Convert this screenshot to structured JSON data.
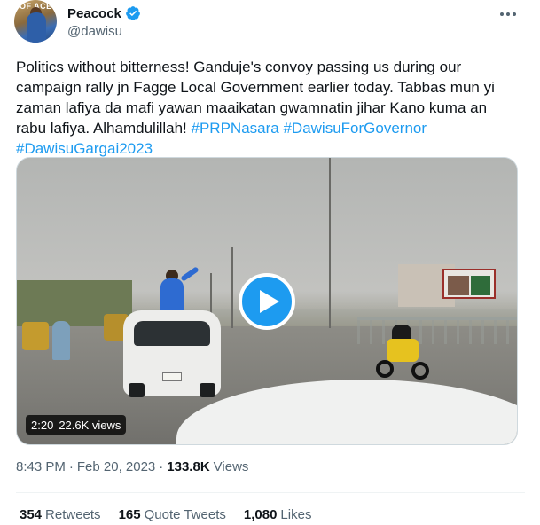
{
  "author": {
    "display_name": "Peacock",
    "handle": "@dawisu",
    "avatar_text": "OF ACE",
    "verified_icon": "verified-badge-icon",
    "accent_color": "#1d9bf0"
  },
  "tweet": {
    "text_before": "Politics without bitterness! Ganduje's convoy passing us during our campaign rally jn Fagge Local Government earlier today. Tabbas mun yi zaman lafiya da mafi yawan maaikatan gwamnatin jihar Kano kuma an rabu lafiya. Alhamdulillah! ",
    "hashtags": [
      "#PRPNasara",
      "#DawisuForGovernor",
      "#DawisuGargai2023"
    ]
  },
  "media": {
    "duration": "2:20",
    "views": "22.6K views",
    "play_icon": "play-icon"
  },
  "meta": {
    "time": "8:43 PM",
    "separator": "·",
    "date": "Feb 20, 2023",
    "views_count": "133.8K",
    "views_label": "Views"
  },
  "stats": {
    "retweets_count": "354",
    "retweets_label": "Retweets",
    "quotes_count": "165",
    "quotes_label": "Quote Tweets",
    "likes_count": "1,080",
    "likes_label": "Likes"
  }
}
